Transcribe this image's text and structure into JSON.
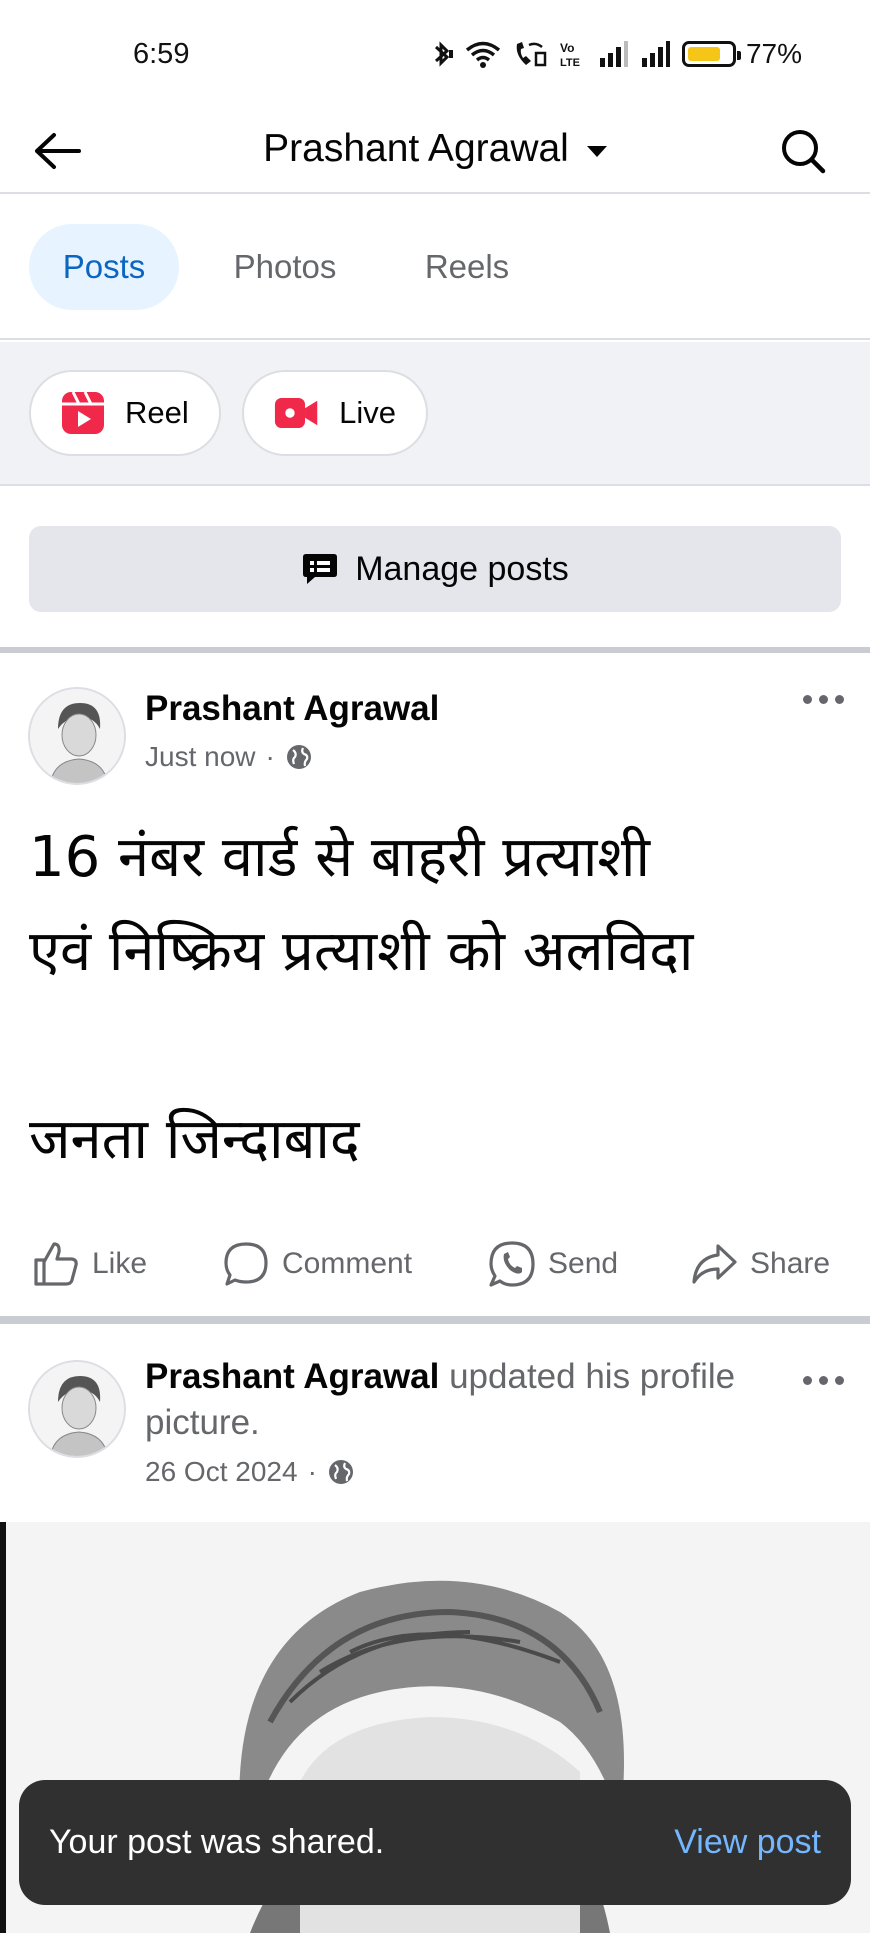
{
  "status_bar": {
    "time": "6:59",
    "battery": "77%",
    "battery_color": "#f5c518",
    "icons": [
      "bluetooth-icon",
      "wifi-icon",
      "wifi-calling-icon",
      "volte-icon",
      "signal-icon",
      "signal-icon",
      "battery-icon"
    ]
  },
  "header": {
    "title": "Prashant Agrawal",
    "back_icon": "back-arrow-icon",
    "search_icon": "search-icon"
  },
  "tabs": [
    {
      "label": "Posts",
      "active": true
    },
    {
      "label": "Photos",
      "active": false
    },
    {
      "label": "Reels",
      "active": false
    }
  ],
  "create": {
    "reel_label": "Reel",
    "live_label": "Live",
    "icon_color": "#f02849"
  },
  "manage": {
    "label": "Manage posts"
  },
  "posts": [
    {
      "author": "Prashant Agrawal",
      "time": "Just now",
      "text": "16 नंबर वार्ड से बाहरी प्रत्याशी\nएवं निष्क्रिय प्रत्याशी को अलविदा\n\nजनता जिन्दाबाद",
      "actions": {
        "like": "Like",
        "comment": "Comment",
        "send": "Send",
        "share": "Share"
      }
    },
    {
      "author": "Prashant Agrawal",
      "action_text": "updated his profile picture.",
      "time": "26 Oct 2024"
    }
  ],
  "snackbar": {
    "message": "Your post was shared.",
    "action": "View post",
    "action_color": "#74b7ff"
  },
  "accent_color": "#0a66c2"
}
